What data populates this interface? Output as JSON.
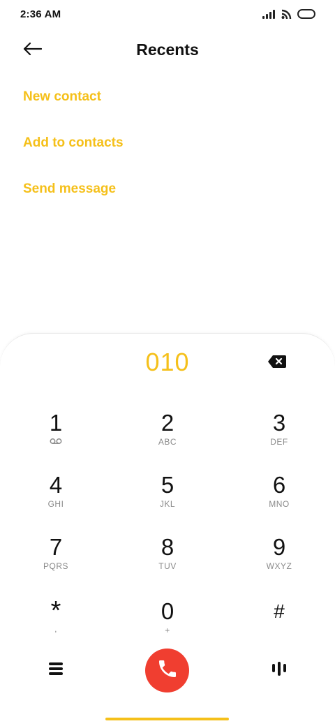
{
  "status_bar": {
    "time": "2:36 AM",
    "icons": [
      "signal-icon",
      "wifi-icon",
      "battery-icon"
    ]
  },
  "header": {
    "back_icon": "back-arrow-icon",
    "title": "Recents"
  },
  "actions": [
    {
      "label": "New contact"
    },
    {
      "label": "Add to contacts"
    },
    {
      "label": "Send message"
    }
  ],
  "dialer": {
    "number": "010",
    "backspace_icon": "backspace-icon",
    "keys": [
      {
        "digit": "1",
        "sub": "",
        "sub_icon": "voicemail-icon"
      },
      {
        "digit": "2",
        "sub": "ABC"
      },
      {
        "digit": "3",
        "sub": "DEF"
      },
      {
        "digit": "4",
        "sub": "GHI"
      },
      {
        "digit": "5",
        "sub": "JKL"
      },
      {
        "digit": "6",
        "sub": "MNO"
      },
      {
        "digit": "7",
        "sub": "PQRS"
      },
      {
        "digit": "8",
        "sub": "TUV"
      },
      {
        "digit": "9",
        "sub": "WXYZ"
      },
      {
        "digit": "*",
        "sub": ","
      },
      {
        "digit": "0",
        "sub": "+"
      },
      {
        "digit": "#",
        "sub": ""
      }
    ],
    "bottom": {
      "menu_icon": "menu-icon",
      "call_icon": "phone-icon",
      "keypad_toggle_icon": "keypad-toggle-icon"
    }
  },
  "colors": {
    "accent": "#f5c01a",
    "call": "#f03e30",
    "text": "#111111",
    "subtext": "#8a8a8a"
  }
}
